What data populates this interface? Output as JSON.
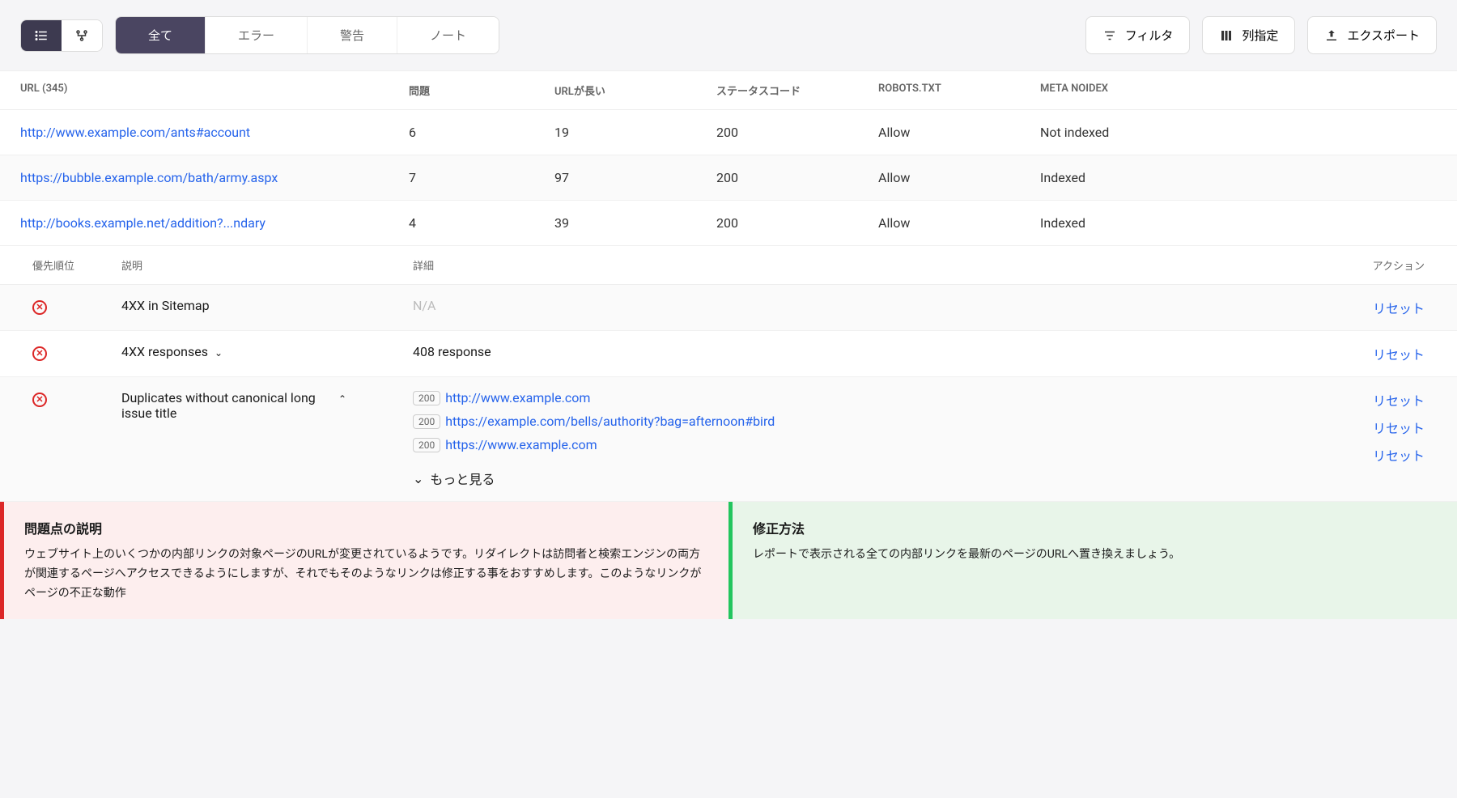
{
  "toolbar": {
    "tabs": {
      "all": "全て",
      "error": "エラー",
      "warning": "警告",
      "note": "ノート"
    },
    "filter": "フィルタ",
    "columns": "列指定",
    "export": "エクスポート"
  },
  "table": {
    "headers": {
      "url": "URL (345)",
      "issues": "問題",
      "url_long": "URLが長い",
      "status": "ステータスコード",
      "robots": "ROBOTS.TXT",
      "meta": "META NOIDEX"
    },
    "rows": [
      {
        "url": "http://www.example.com/ants#account",
        "issues": "6",
        "url_long": "19",
        "status": "200",
        "robots": "Allow",
        "meta": "Not indexed"
      },
      {
        "url": "https://bubble.example.com/bath/army.aspx",
        "issues": "7",
        "url_long": "97",
        "status": "200",
        "robots": "Allow",
        "meta": "Indexed"
      },
      {
        "url": "http://books.example.net/addition?...ndary",
        "issues": "4",
        "url_long": "39",
        "status": "200",
        "robots": "Allow",
        "meta": "Indexed"
      }
    ]
  },
  "sub": {
    "headers": {
      "priority": "優先順位",
      "desc": "説明",
      "detail": "詳細",
      "action": "アクション"
    },
    "reset": "リセット",
    "more": "もっと見る",
    "rows": [
      {
        "desc": "4XX in Sitemap",
        "detail_na": "N/A"
      },
      {
        "desc": "4XX responses",
        "detail": "408 response"
      }
    ],
    "dup": {
      "desc": "Duplicates without canonical long issue title",
      "items": [
        {
          "badge": "200",
          "url": "http://www.example.com"
        },
        {
          "badge": "200",
          "url": "https://example.com/bells/authority?bag=afternoon#bird"
        },
        {
          "badge": "200",
          "url": "https://www.example.com"
        }
      ]
    }
  },
  "panels": {
    "left_title": "問題点の説明",
    "left_body": "ウェブサイト上のいくつかの内部リンクの対象ページのURLが変更されているようです。リダイレクトは訪問者と検索エンジンの両方が関連するページへアクセスできるようにしますが、それでもそのようなリンクは修正する事をおすすめします。このようなリンクがページの不正な動作",
    "right_title": "修正方法",
    "right_body": "レポートで表示される全ての内部リンクを最新のページのURLへ置き換えましょう。"
  }
}
